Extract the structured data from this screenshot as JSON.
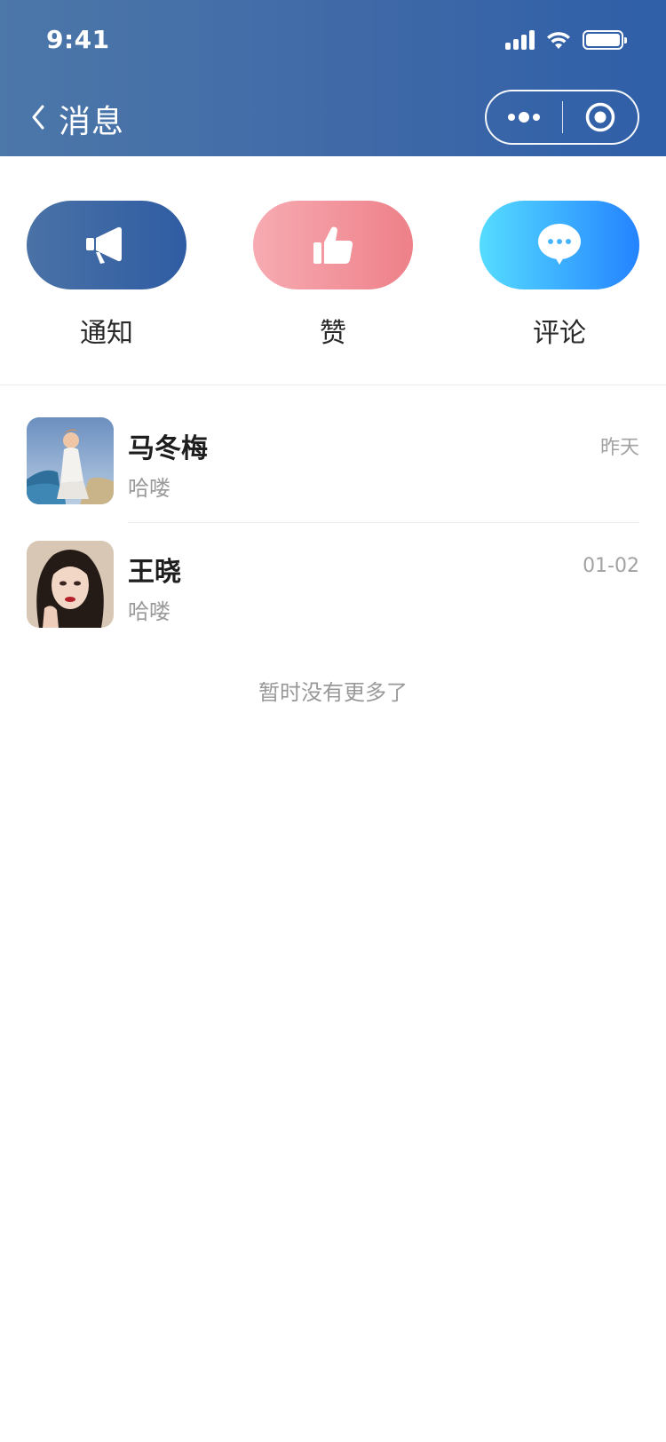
{
  "status_bar": {
    "time": "9:41"
  },
  "nav": {
    "title": "消息"
  },
  "categories": [
    {
      "label": "通知",
      "icon": "megaphone-icon"
    },
    {
      "label": "赞",
      "icon": "thumbs-up-icon"
    },
    {
      "label": "评论",
      "icon": "comment-bubble-icon"
    }
  ],
  "messages": [
    {
      "name": "马冬梅",
      "preview": "哈喽",
      "time": "昨天"
    },
    {
      "name": "王晓",
      "preview": "哈喽",
      "time": "01-02"
    }
  ],
  "end_text": "暂时没有更多了",
  "colors": {
    "header_start": "#4c77a9",
    "header_end": "#2f5fa8",
    "notify_gradient": [
      "#4a72a6",
      "#2f5ca3"
    ],
    "like_gradient": [
      "#f7abb2",
      "#ee8089"
    ],
    "comment_gradient": [
      "#55dcff",
      "#2483ff"
    ]
  }
}
